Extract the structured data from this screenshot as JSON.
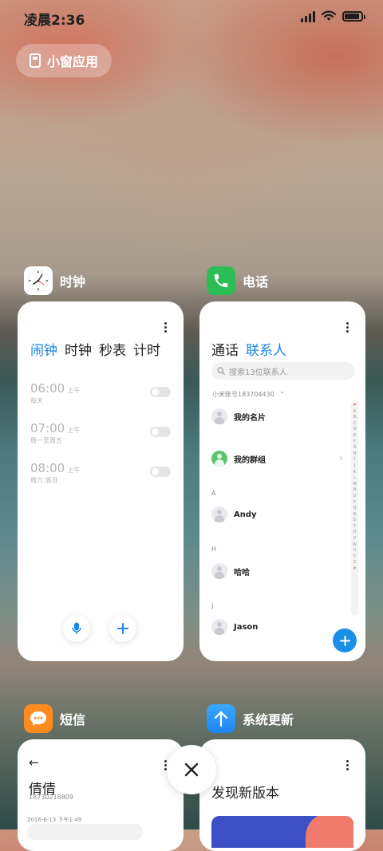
{
  "status_bar": {
    "time": "凌晨2:36"
  },
  "small_window_button": {
    "label": "小窗应用"
  },
  "apps": {
    "clock": {
      "name": "时钟",
      "tabs": [
        "闹钟",
        "时钟",
        "秒表",
        "计时"
      ],
      "alarms": [
        {
          "time": "06:00",
          "ampm": "上午",
          "days": "每天"
        },
        {
          "time": "07:00",
          "ampm": "上午",
          "days": "周一至周五"
        },
        {
          "time": "08:00",
          "ampm": "上午",
          "days": "周六 周日"
        }
      ]
    },
    "phone": {
      "name": "电话",
      "tabs": [
        "通话",
        "联系人"
      ],
      "search_placeholder": "搜索13位联系人",
      "account": "小米账号183704430",
      "contacts": {
        "my_card": "我的名片",
        "my_groups": "我的群组",
        "andy": "Andy",
        "haha": "哈哈",
        "jason": "Jason"
      },
      "section_letters": [
        "A",
        "H",
        "J"
      ],
      "index_letters": [
        "❤",
        "A",
        "B",
        "C",
        "D",
        "E",
        "F",
        "G",
        "H",
        "I",
        "J",
        "K",
        "L",
        "M",
        "N",
        "O",
        "P",
        "Q",
        "R",
        "S",
        "T",
        "U",
        "V",
        "W",
        "X",
        "Y",
        "Z",
        "#"
      ]
    },
    "sms": {
      "name": "短信",
      "contact_name": "倩倩",
      "contact_number": "18730218809",
      "timestamp": "2016-6-13 下午1:49"
    },
    "update": {
      "name": "系统更新",
      "headline": "发现新版本"
    }
  },
  "colors": {
    "accent": "#1a87e6",
    "clock_icon_bg": "#ffffff",
    "phone_icon_bg": "#2dbd57",
    "sms_icon_bg": "#ff8a1e",
    "update_icon_bg": "#2196f3"
  }
}
